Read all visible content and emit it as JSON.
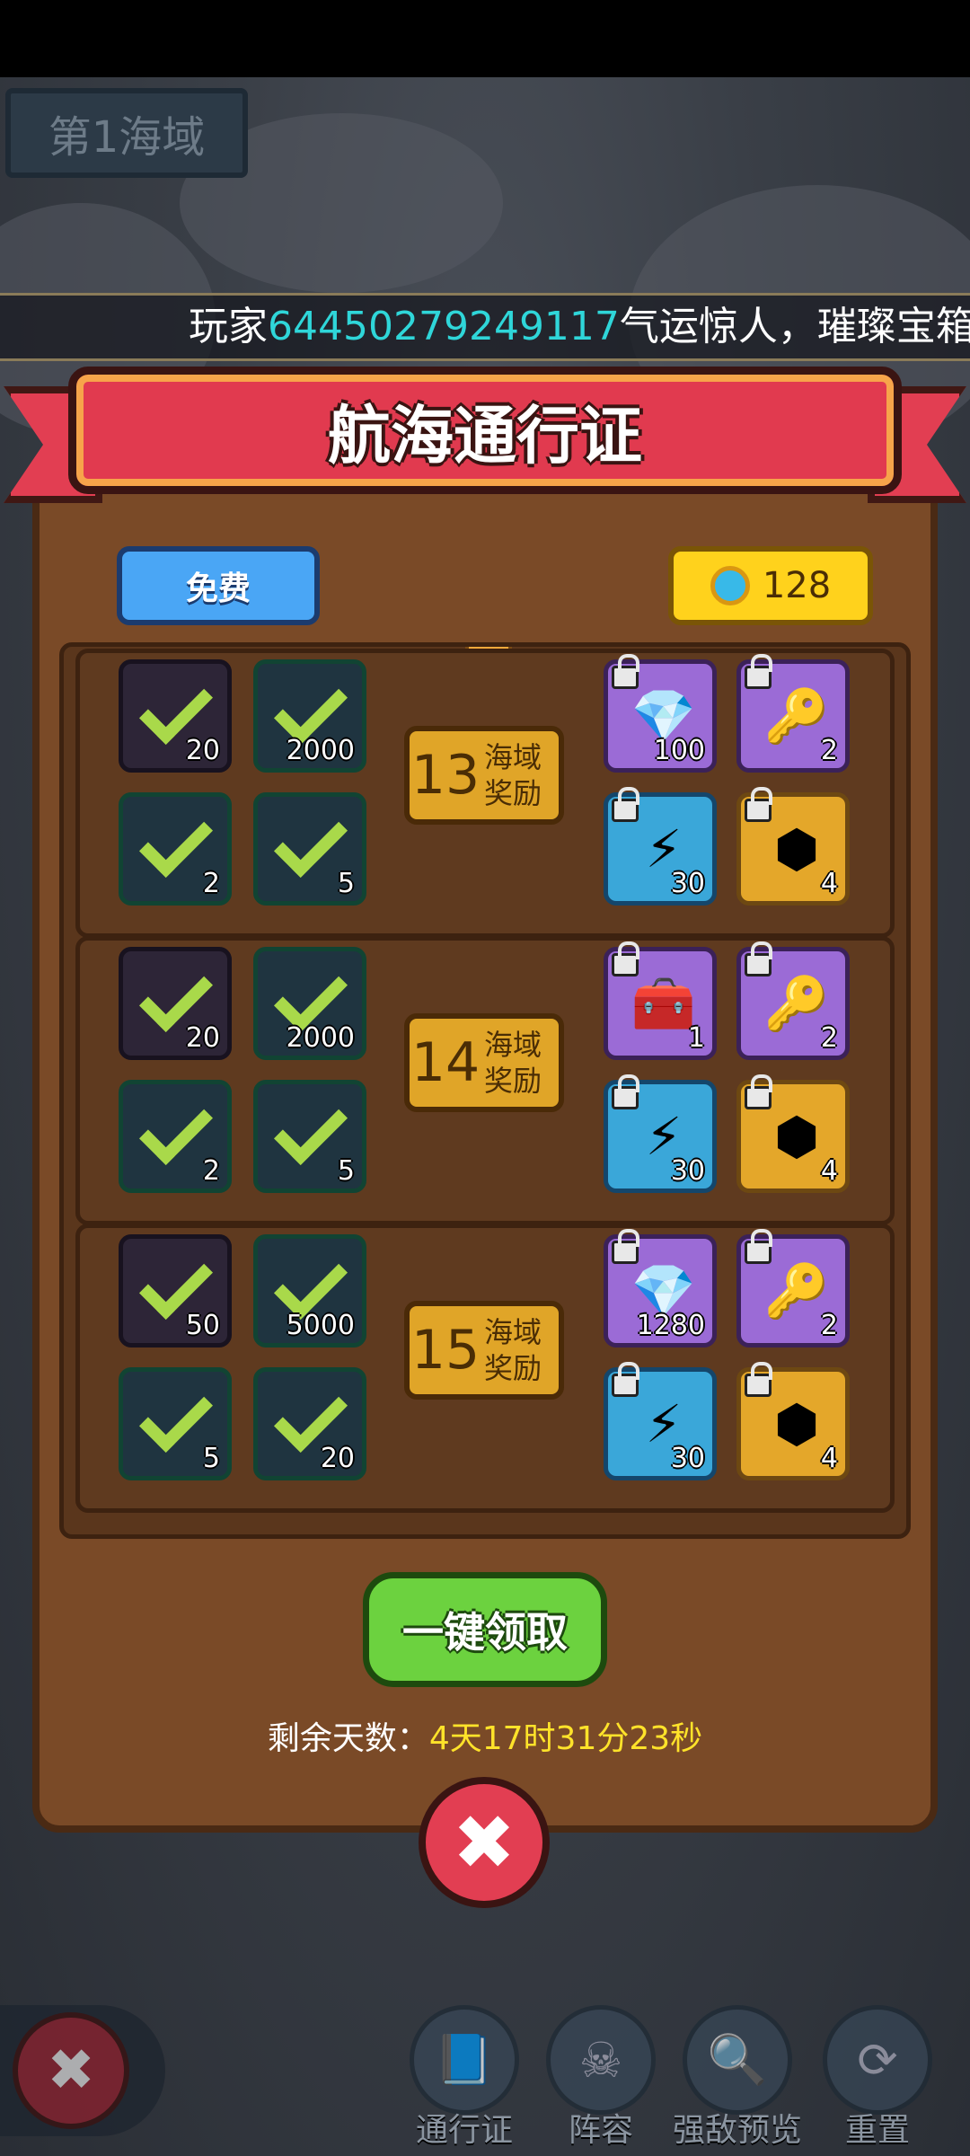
{
  "sea_label": "第1海域",
  "ticker": {
    "prefix": "玩家",
    "player_id": "64450279249117",
    "suffix": "气运惊人，璀璨宝箱中"
  },
  "title": "航海通行证",
  "free_label": "免费",
  "coins": "128",
  "rows": [
    {
      "level": "13",
      "level_label_1": "海域",
      "level_label_2": "奖励",
      "free": [
        "20",
        "2000",
        "2",
        "5"
      ],
      "paid": [
        {
          "icon": "pink-gem-icon",
          "glyph": "💎",
          "qty": "100"
        },
        {
          "icon": "gold-key-icon",
          "glyph": "🔑",
          "qty": "2"
        },
        {
          "icon": "lightning-icon",
          "glyph": "⚡",
          "qty": "30"
        },
        {
          "icon": "gold-hexagon-icon",
          "glyph": "⬢",
          "qty": "4"
        }
      ]
    },
    {
      "level": "14",
      "level_label_1": "海域",
      "level_label_2": "奖励",
      "free": [
        "20",
        "2000",
        "2",
        "5"
      ],
      "paid": [
        {
          "icon": "treasure-chest-icon",
          "glyph": "🧰",
          "qty": "1"
        },
        {
          "icon": "gold-key-icon",
          "glyph": "🔑",
          "qty": "2"
        },
        {
          "icon": "lightning-icon",
          "glyph": "⚡",
          "qty": "30"
        },
        {
          "icon": "gold-hexagon-icon",
          "glyph": "⬢",
          "qty": "4"
        }
      ]
    },
    {
      "level": "15",
      "level_label_1": "海域",
      "level_label_2": "奖励",
      "free": [
        "50",
        "5000",
        "5",
        "20"
      ],
      "paid": [
        {
          "icon": "pink-gem-icon",
          "glyph": "💎",
          "qty": "1280"
        },
        {
          "icon": "gold-key-icon",
          "glyph": "🔑",
          "qty": "2"
        },
        {
          "icon": "lightning-icon",
          "glyph": "⚡",
          "qty": "30"
        },
        {
          "icon": "gold-hexagon-icon",
          "glyph": "⬢",
          "qty": "4"
        }
      ]
    }
  ],
  "claim_all": "一键领取",
  "remaining_label": "剩余天数：",
  "remaining_value": "4天17时31分23秒",
  "close_glyph": "✖",
  "nav": [
    {
      "label": "通行证",
      "icon": "pass-book-icon",
      "glyph": "📘"
    },
    {
      "label": "阵容",
      "icon": "pirate-avatar-icon",
      "glyph": "☠"
    },
    {
      "label": "强敌预览",
      "icon": "magnifier-icon",
      "glyph": "🔍"
    },
    {
      "label": "重置",
      "icon": "reset-arrows-icon",
      "glyph": "⟳"
    }
  ],
  "colors": {
    "ribbon": "#e13a4f",
    "accent_id": "#2fd6d9",
    "timer": "#ffe32a",
    "claim": "#6cd23f"
  }
}
